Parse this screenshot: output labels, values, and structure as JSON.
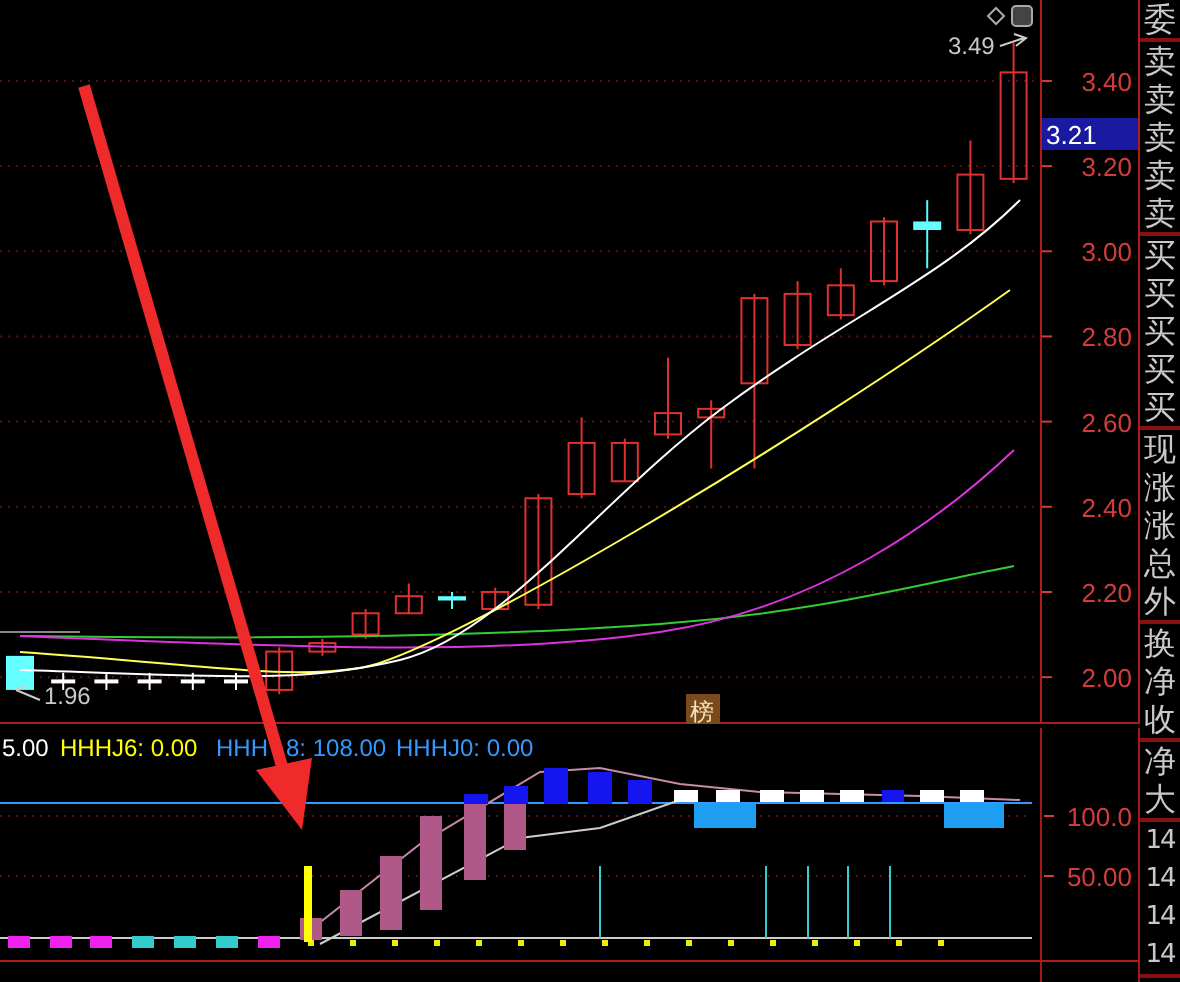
{
  "price_chart": {
    "chart_data": {
      "type": "candlestick",
      "grid": true,
      "ylim": [
        1.89,
        3.59
      ],
      "yticks": [
        {
          "value": 3.4,
          "label": "3.40"
        },
        {
          "value": 3.2,
          "label": "3.20"
        },
        {
          "value": 3.0,
          "label": "3.00"
        },
        {
          "value": 2.8,
          "label": "2.80"
        },
        {
          "value": 2.6,
          "label": "2.60"
        },
        {
          "value": 2.4,
          "label": "2.40"
        },
        {
          "value": 2.2,
          "label": "2.20"
        },
        {
          "value": 2.0,
          "label": "2.00"
        }
      ],
      "ohlc": [
        [
          2.05,
          2.05,
          1.97,
          1.97
        ],
        [
          1.99,
          2.01,
          1.97,
          1.99
        ],
        [
          1.99,
          2.01,
          1.97,
          1.99
        ],
        [
          1.99,
          2.01,
          1.97,
          1.99
        ],
        [
          1.99,
          2.01,
          1.97,
          1.99
        ],
        [
          1.99,
          2.01,
          1.97,
          1.99
        ],
        [
          1.97,
          2.07,
          1.96,
          2.06
        ],
        [
          2.06,
          2.09,
          2.05,
          2.08
        ],
        [
          2.1,
          2.16,
          2.09,
          2.15
        ],
        [
          2.15,
          2.22,
          2.15,
          2.19
        ],
        [
          2.19,
          2.2,
          2.16,
          2.18
        ],
        [
          2.16,
          2.21,
          2.16,
          2.2
        ],
        [
          2.17,
          2.43,
          2.16,
          2.42
        ],
        [
          2.43,
          2.61,
          2.42,
          2.55
        ],
        [
          2.46,
          2.56,
          2.46,
          2.55
        ],
        [
          2.57,
          2.75,
          2.56,
          2.62
        ],
        [
          2.61,
          2.65,
          2.49,
          2.63
        ],
        [
          2.69,
          2.9,
          2.49,
          2.89
        ],
        [
          2.78,
          2.93,
          2.77,
          2.9
        ],
        [
          2.85,
          2.96,
          2.84,
          2.92
        ],
        [
          2.93,
          3.08,
          2.92,
          3.07
        ],
        [
          3.07,
          3.12,
          2.96,
          3.05
        ],
        [
          3.05,
          3.26,
          3.04,
          3.18
        ],
        [
          3.17,
          3.49,
          3.16,
          3.42
        ]
      ]
    },
    "price_tag": "3.21",
    "high_marker": "3.49",
    "low_marker": "1.96",
    "badge": "榜"
  },
  "indicator": {
    "legend": [
      {
        "text": "5.00",
        "color": "#ffffff"
      },
      {
        "text": "HHHJ6: 0.00",
        "color": "#ffff00"
      },
      {
        "text": "HHH",
        "color": "#3399ff"
      },
      {
        "text": "8: 108.00",
        "color": "#3399ff"
      },
      {
        "text": "HHHJ0: 0.00",
        "color": "#3399ff"
      }
    ],
    "axis_labels": [
      "100.0",
      "50.00"
    ]
  },
  "side_panel": {
    "groups": [
      [
        "委"
      ],
      [
        "卖",
        "卖",
        "卖",
        "卖",
        "卖"
      ],
      [
        "买",
        "买",
        "买",
        "买",
        "买"
      ],
      [
        "现",
        "涨",
        "涨",
        "总",
        "外"
      ],
      [
        "换",
        "净",
        "收"
      ],
      [
        "净",
        "大"
      ],
      [
        "14",
        "14",
        "14",
        "14"
      ]
    ]
  }
}
